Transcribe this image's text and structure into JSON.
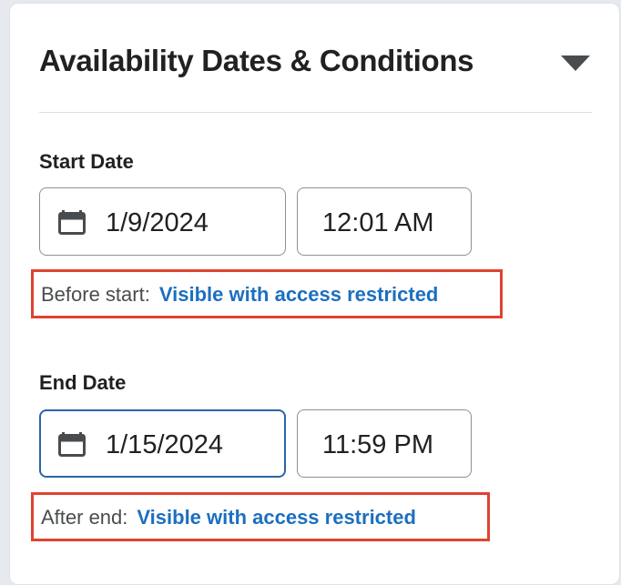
{
  "panel": {
    "title": "Availability Dates & Conditions",
    "toggle_icon": "triangle-down-icon"
  },
  "start": {
    "label": "Start Date",
    "date": "1/9/2024",
    "time": "12:01 AM",
    "visibility_prefix": "Before start:",
    "visibility_link": "Visible with access restricted"
  },
  "end": {
    "label": "End Date",
    "date": "1/15/2024",
    "time": "11:59 PM",
    "visibility_prefix": "After end:",
    "visibility_link": "Visible with access restricted"
  },
  "colors": {
    "accent_link": "#1c6fc0",
    "focus_border": "#2a64a8",
    "highlight_box": "#e0432f"
  }
}
